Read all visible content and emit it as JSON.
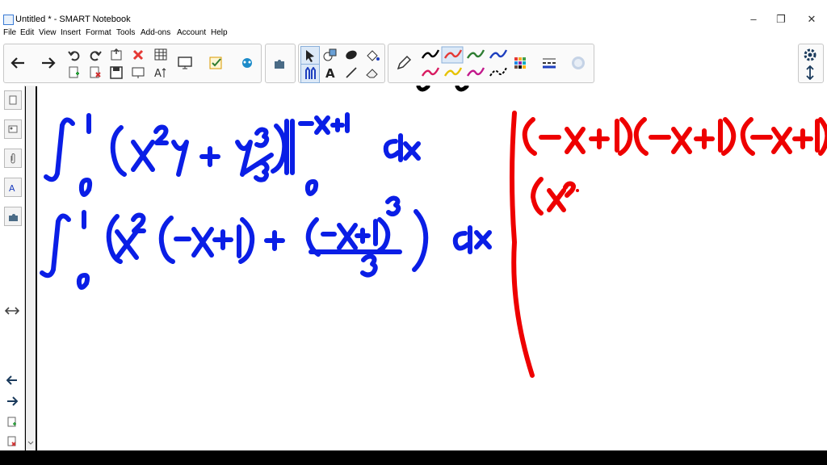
{
  "window": {
    "title": "Untitled * - SMART Notebook",
    "minimize": "–",
    "restore": "❐",
    "close": "✕"
  },
  "menu": [
    "File",
    "Edit",
    "View",
    "Insert",
    "Format",
    "Tools",
    "Add-ons",
    "Account",
    "Help"
  ],
  "toolbar": {
    "back": "arrow-left-icon",
    "forward": "arrow-right-icon",
    "pen_colors": [
      "#000000",
      "#e53935",
      "#2e7d32",
      "#1e3fbf",
      "#d81b60",
      "#e6c200",
      "#c2188b",
      "#000000"
    ]
  },
  "ink": {
    "blue": "#0a1ee6",
    "red": "#ee0000"
  }
}
